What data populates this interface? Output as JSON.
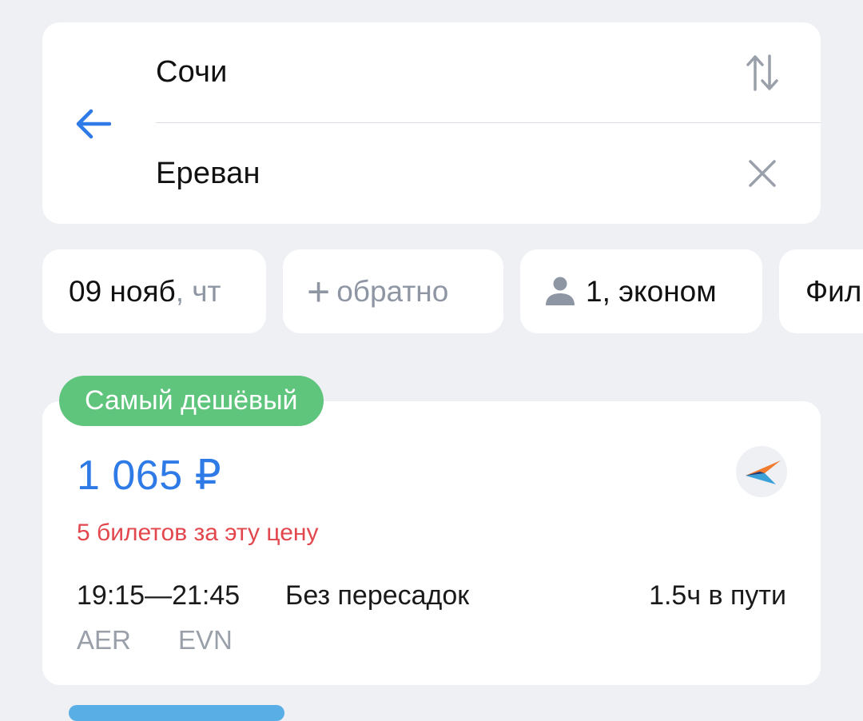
{
  "route": {
    "from": "Сочи",
    "to": "Ереван",
    "back_icon": "arrow-left-icon",
    "swap_icon": "swap-vertical-icon",
    "clear_icon": "close-icon"
  },
  "filters": {
    "date": "09 нояб",
    "weekday": ", чт",
    "return_plus": "+",
    "return_label": "обратно",
    "passengers": "1, эконом",
    "passengers_icon": "person-icon",
    "filters_label": "Фил"
  },
  "ticket": {
    "badge": "Самый дешёвый",
    "price": "1 065 ₽",
    "tickets_left": "5 билетов за эту цену",
    "departure_time": "19:15",
    "arrival_time": "21:45",
    "times_separator": "—",
    "stops": "Без пересадок",
    "duration": "1.5ч в пути",
    "departure_airport": "AER",
    "arrival_airport": "EVN",
    "airline_icon": "airline-logo-icon"
  },
  "colors": {
    "accent": "#2e7ae6",
    "badge_green": "#5fc47c",
    "warning_red": "#e2474e",
    "muted": "#8f96a3",
    "background": "#eef0f4"
  }
}
